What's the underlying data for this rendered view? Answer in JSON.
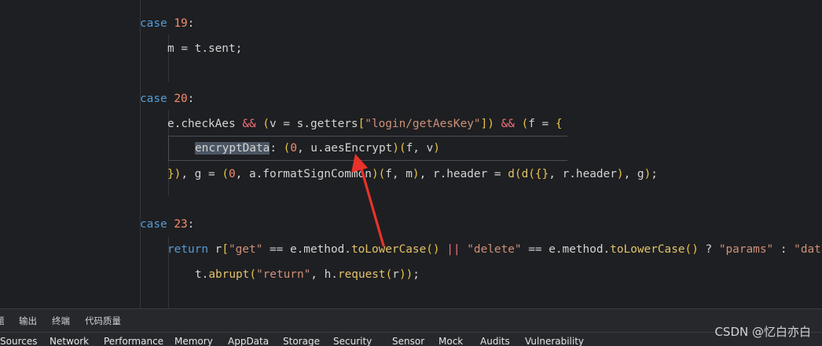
{
  "code": {
    "case19": "case",
    "case19_num": "19",
    "line_m": [
      "m",
      "=",
      "t.sent;"
    ],
    "case20": "case",
    "case20_num": "20",
    "case23": "case",
    "case23_num": "23"
  },
  "bottom_tabs": [
    "题",
    "输出",
    "终端",
    "代码质量"
  ],
  "devtools_tabs": [
    "Sources",
    "Network",
    "Performance",
    "Memory",
    "AppData",
    "Storage",
    "Security",
    "Sensor",
    "Mock",
    "Audits",
    "Vulnerability"
  ],
  "watermark": "CSDN @忆白亦白",
  "colors": {
    "annotation_arrow": "#e8322b",
    "editor_bg": "#1e1f22"
  }
}
